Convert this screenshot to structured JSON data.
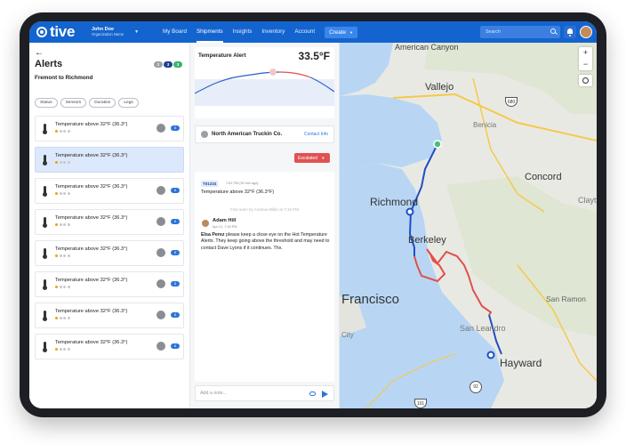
{
  "nav": {
    "logo": "tive",
    "user_name": "John Doe",
    "user_org": "Organization Name",
    "menu": [
      "My Board",
      "Shipments",
      "Insights",
      "Inventory",
      "Account"
    ],
    "active_menu": "Shipments",
    "create_label": "Create",
    "search_placeholder": "Search"
  },
  "alerts_panel": {
    "title": "Alerts",
    "badges": [
      {
        "value": "2",
        "color": "#9aa0a6"
      },
      {
        "value": "3",
        "color": "#1f3f8f"
      },
      {
        "value": "3",
        "color": "#35b56a"
      }
    ],
    "route": "Fremont to Richmond",
    "filters": [
      "Status",
      "Sensors",
      "Duration",
      "Legs"
    ],
    "items": [
      {
        "title": "Temperature above 32°F (36.3°)",
        "rating": 1,
        "count": "8",
        "selected": false
      },
      {
        "title": "Temperature above 32°F (36.3°)",
        "rating": 1,
        "count": "",
        "selected": true
      },
      {
        "title": "Temperature above 32°F (36.3°)",
        "rating": 1,
        "count": "8",
        "selected": false
      },
      {
        "title": "Temperature above 32°F (36.3°)",
        "rating": 1,
        "count": "8",
        "selected": false
      },
      {
        "title": "Temperature above 32°F (36.3°)",
        "rating": 1,
        "count": "8",
        "selected": false
      },
      {
        "title": "Temperature above 32°F (36.3°)",
        "rating": 1,
        "count": "8",
        "selected": false
      },
      {
        "title": "Temperature above 32°F (36.3°)",
        "rating": 1,
        "count": "8",
        "selected": false
      },
      {
        "title": "Temperature above 32°F (36.3°)",
        "rating": 1,
        "count": "8",
        "selected": false
      }
    ]
  },
  "detail": {
    "alert_label": "Temperature Alert",
    "temperature": "33.5°F",
    "carrier": "North American Truckin Co.",
    "contact_label": "Contact Info",
    "status": "Escalated",
    "thread_id": "T01234",
    "thread_time": "7:51 PM (30 min ago)",
    "thread_message": "Temperature above 32°F (36.3°F)",
    "seen_text": "First seen by Andrew Miller at 7:15 PM",
    "comment_author": "Adam Hill",
    "comment_date": "Apr 21, 7:30 PM",
    "comment_mention": "Elsa Perez",
    "comment_text": " please keep a close eye on the Hot Temperature Alerts. They keep going above the threshold and may need to contact Dave Lyons if it continues. Thx.",
    "note_placeholder": "Add a note..."
  },
  "map": {
    "labels": [
      {
        "text": "American Canyon",
        "size": "big"
      },
      {
        "text": "Vallejo",
        "size": "big"
      },
      {
        "text": "Benicia",
        "size": "small"
      },
      {
        "text": "Concord",
        "size": "big"
      },
      {
        "text": "Clayt",
        "size": "small"
      },
      {
        "text": "Richmond",
        "size": "big"
      },
      {
        "text": "Berkeley",
        "size": "big"
      },
      {
        "text": "Francisco",
        "size": "big"
      },
      {
        "text": "San Ramon",
        "size": "small"
      },
      {
        "text": "San Leandro",
        "size": "small"
      },
      {
        "text": "City",
        "size": "small"
      },
      {
        "text": "Hayward",
        "size": "big"
      }
    ],
    "highways": [
      "680",
      "92",
      "101"
    ],
    "route_color_ok": "#1f4fc4",
    "route_color_alert": "#e0504a",
    "zoom_in": "+",
    "zoom_out": "−"
  }
}
